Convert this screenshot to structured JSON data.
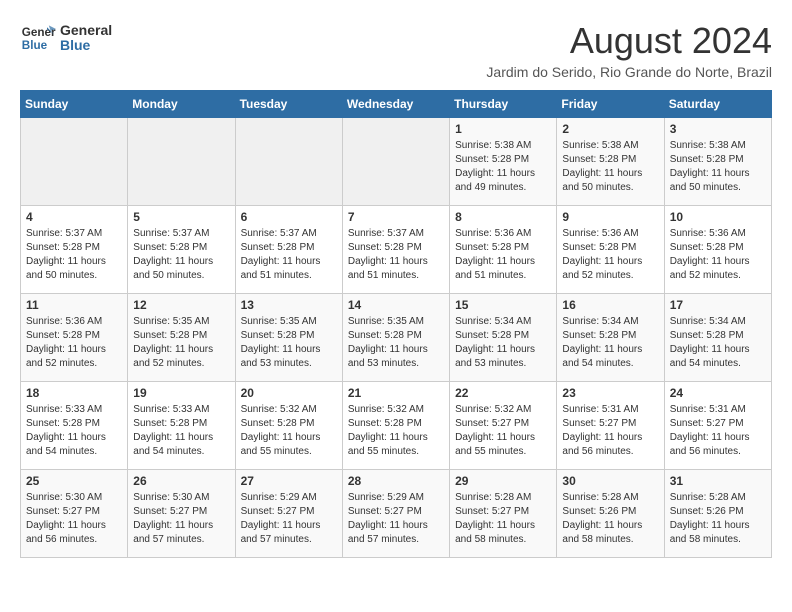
{
  "header": {
    "logo_general": "General",
    "logo_blue": "Blue",
    "month_year": "August 2024",
    "location": "Jardim do Serido, Rio Grande do Norte, Brazil"
  },
  "days_of_week": [
    "Sunday",
    "Monday",
    "Tuesday",
    "Wednesday",
    "Thursday",
    "Friday",
    "Saturday"
  ],
  "weeks": [
    [
      {
        "day": "",
        "info": ""
      },
      {
        "day": "",
        "info": ""
      },
      {
        "day": "",
        "info": ""
      },
      {
        "day": "",
        "info": ""
      },
      {
        "day": "1",
        "info": "Sunrise: 5:38 AM\nSunset: 5:28 PM\nDaylight: 11 hours\nand 49 minutes."
      },
      {
        "day": "2",
        "info": "Sunrise: 5:38 AM\nSunset: 5:28 PM\nDaylight: 11 hours\nand 50 minutes."
      },
      {
        "day": "3",
        "info": "Sunrise: 5:38 AM\nSunset: 5:28 PM\nDaylight: 11 hours\nand 50 minutes."
      }
    ],
    [
      {
        "day": "4",
        "info": "Sunrise: 5:37 AM\nSunset: 5:28 PM\nDaylight: 11 hours\nand 50 minutes."
      },
      {
        "day": "5",
        "info": "Sunrise: 5:37 AM\nSunset: 5:28 PM\nDaylight: 11 hours\nand 50 minutes."
      },
      {
        "day": "6",
        "info": "Sunrise: 5:37 AM\nSunset: 5:28 PM\nDaylight: 11 hours\nand 51 minutes."
      },
      {
        "day": "7",
        "info": "Sunrise: 5:37 AM\nSunset: 5:28 PM\nDaylight: 11 hours\nand 51 minutes."
      },
      {
        "day": "8",
        "info": "Sunrise: 5:36 AM\nSunset: 5:28 PM\nDaylight: 11 hours\nand 51 minutes."
      },
      {
        "day": "9",
        "info": "Sunrise: 5:36 AM\nSunset: 5:28 PM\nDaylight: 11 hours\nand 52 minutes."
      },
      {
        "day": "10",
        "info": "Sunrise: 5:36 AM\nSunset: 5:28 PM\nDaylight: 11 hours\nand 52 minutes."
      }
    ],
    [
      {
        "day": "11",
        "info": "Sunrise: 5:36 AM\nSunset: 5:28 PM\nDaylight: 11 hours\nand 52 minutes."
      },
      {
        "day": "12",
        "info": "Sunrise: 5:35 AM\nSunset: 5:28 PM\nDaylight: 11 hours\nand 52 minutes."
      },
      {
        "day": "13",
        "info": "Sunrise: 5:35 AM\nSunset: 5:28 PM\nDaylight: 11 hours\nand 53 minutes."
      },
      {
        "day": "14",
        "info": "Sunrise: 5:35 AM\nSunset: 5:28 PM\nDaylight: 11 hours\nand 53 minutes."
      },
      {
        "day": "15",
        "info": "Sunrise: 5:34 AM\nSunset: 5:28 PM\nDaylight: 11 hours\nand 53 minutes."
      },
      {
        "day": "16",
        "info": "Sunrise: 5:34 AM\nSunset: 5:28 PM\nDaylight: 11 hours\nand 54 minutes."
      },
      {
        "day": "17",
        "info": "Sunrise: 5:34 AM\nSunset: 5:28 PM\nDaylight: 11 hours\nand 54 minutes."
      }
    ],
    [
      {
        "day": "18",
        "info": "Sunrise: 5:33 AM\nSunset: 5:28 PM\nDaylight: 11 hours\nand 54 minutes."
      },
      {
        "day": "19",
        "info": "Sunrise: 5:33 AM\nSunset: 5:28 PM\nDaylight: 11 hours\nand 54 minutes."
      },
      {
        "day": "20",
        "info": "Sunrise: 5:32 AM\nSunset: 5:28 PM\nDaylight: 11 hours\nand 55 minutes."
      },
      {
        "day": "21",
        "info": "Sunrise: 5:32 AM\nSunset: 5:28 PM\nDaylight: 11 hours\nand 55 minutes."
      },
      {
        "day": "22",
        "info": "Sunrise: 5:32 AM\nSunset: 5:27 PM\nDaylight: 11 hours\nand 55 minutes."
      },
      {
        "day": "23",
        "info": "Sunrise: 5:31 AM\nSunset: 5:27 PM\nDaylight: 11 hours\nand 56 minutes."
      },
      {
        "day": "24",
        "info": "Sunrise: 5:31 AM\nSunset: 5:27 PM\nDaylight: 11 hours\nand 56 minutes."
      }
    ],
    [
      {
        "day": "25",
        "info": "Sunrise: 5:30 AM\nSunset: 5:27 PM\nDaylight: 11 hours\nand 56 minutes."
      },
      {
        "day": "26",
        "info": "Sunrise: 5:30 AM\nSunset: 5:27 PM\nDaylight: 11 hours\nand 57 minutes."
      },
      {
        "day": "27",
        "info": "Sunrise: 5:29 AM\nSunset: 5:27 PM\nDaylight: 11 hours\nand 57 minutes."
      },
      {
        "day": "28",
        "info": "Sunrise: 5:29 AM\nSunset: 5:27 PM\nDaylight: 11 hours\nand 57 minutes."
      },
      {
        "day": "29",
        "info": "Sunrise: 5:28 AM\nSunset: 5:27 PM\nDaylight: 11 hours\nand 58 minutes."
      },
      {
        "day": "30",
        "info": "Sunrise: 5:28 AM\nSunset: 5:26 PM\nDaylight: 11 hours\nand 58 minutes."
      },
      {
        "day": "31",
        "info": "Sunrise: 5:28 AM\nSunset: 5:26 PM\nDaylight: 11 hours\nand 58 minutes."
      }
    ]
  ]
}
